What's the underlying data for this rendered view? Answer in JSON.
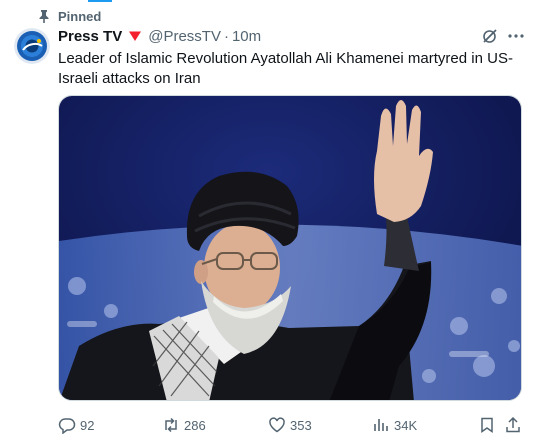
{
  "pinned_label": "Pinned",
  "author": {
    "name": "Press TV",
    "handle": "@PressTV",
    "separator": "·",
    "time": "10m"
  },
  "tweet": {
    "text": "Leader of Islamic Revolution Ayatollah Ali Khamenei martyred in US-Israeli attacks on Iran"
  },
  "actions": {
    "replies": "92",
    "reposts": "286",
    "likes": "353",
    "views": "34K"
  },
  "icons": {
    "pin": "pin-icon",
    "badge": "heart-badge-icon",
    "grok": "grok-icon",
    "more": "more-icon",
    "reply": "reply-icon",
    "repost": "repost-icon",
    "like": "like-icon",
    "views": "views-icon",
    "bookmark": "bookmark-icon",
    "share": "share-icon"
  },
  "colors": {
    "accent": "#1d9bf0",
    "secondary_text": "#536471",
    "badge": "#f4212e"
  }
}
